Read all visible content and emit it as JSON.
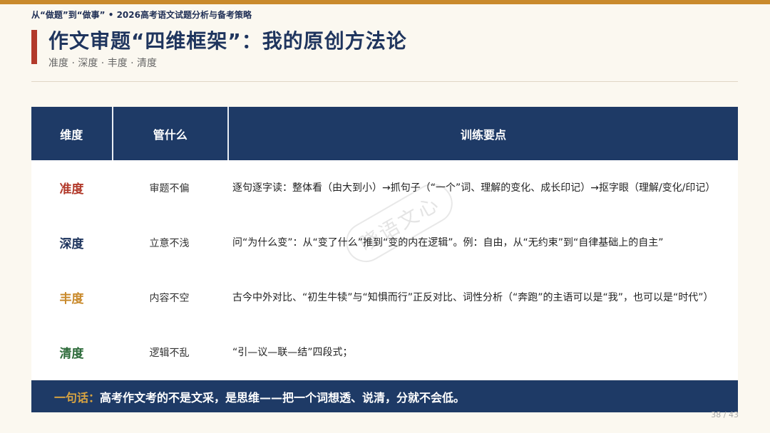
{
  "header": {
    "strap": "从“做题”到“做事” • 2026高考语文试题分析与备考策略"
  },
  "title": "作文审题“四维框架”：我的原创方法论",
  "subtitle": "准度 · 深度 · 丰度 · 清度",
  "table": {
    "headers": [
      "维度",
      "管什么",
      "训练要点"
    ],
    "rows": [
      {
        "dimension": "准度",
        "color": "#b23a2b",
        "scope": "审题不偏",
        "points": "逐句逐字读：整体看（由大到小）→抓句子（“一个”词、理解的变化、成长印记）→抠字眼（理解/变化/印记）"
      },
      {
        "dimension": "深度",
        "color": "#1f355e",
        "scope": "立意不浅",
        "points": "问“为什么变”：从“变了什么”推到“变的内在逻辑”。例：自由，从“无约束”到“自律基础上的自主”"
      },
      {
        "dimension": "丰度",
        "color": "#c98a2c",
        "scope": "内容不空",
        "points": "古今中外对比、“初生牛犊”与“知惧而行”正反对比、词性分析（“奔跑”的主语可以是“我”，也可以是“时代”）"
      },
      {
        "dimension": "清度",
        "color": "#2d6b3a",
        "scope": "逻辑不乱",
        "points": "“引—议—联—结”四段式；"
      }
    ]
  },
  "watermark": "晓语文心",
  "summary": {
    "key": "一句话：",
    "text": "高考作文考的不是文采，是思维——把一个词想透、说清，分就不会低。"
  },
  "page_number": "38 / 43"
}
